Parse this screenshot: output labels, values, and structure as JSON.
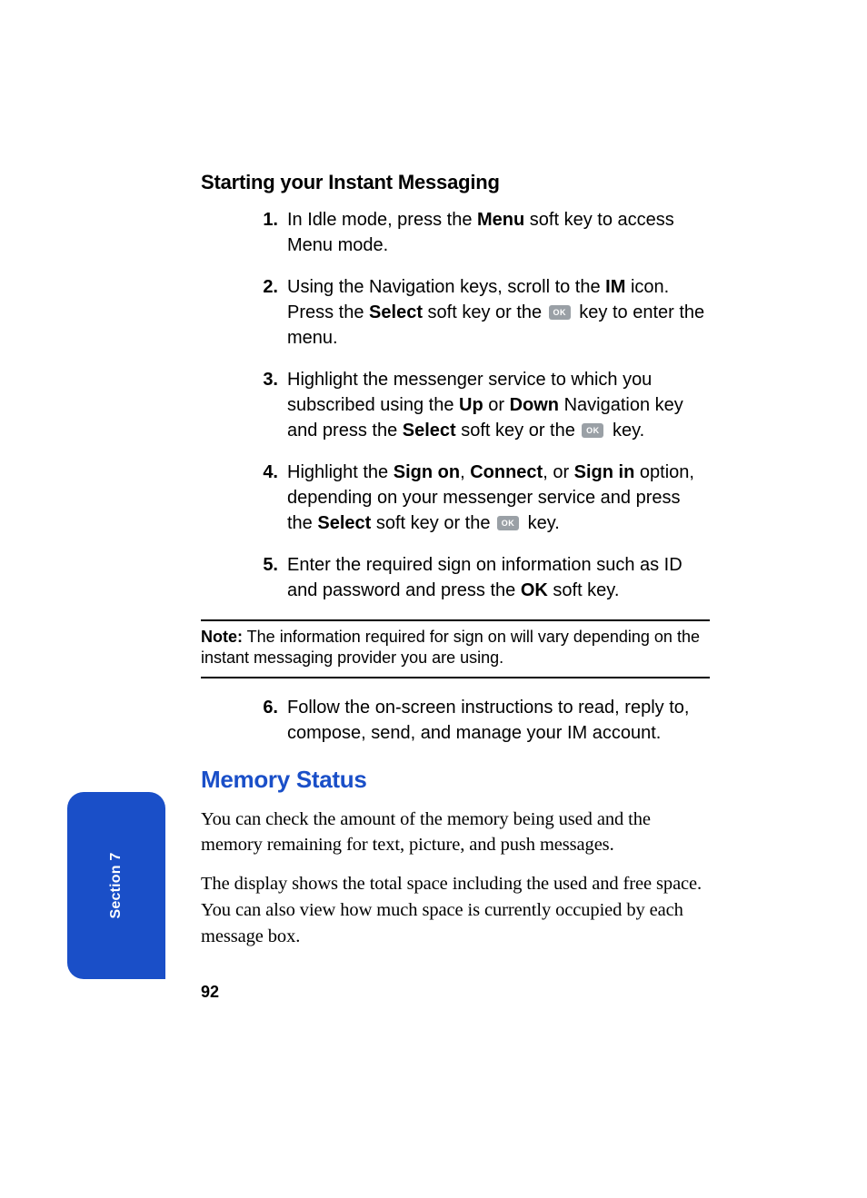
{
  "subheading": "Starting your Instant Messaging",
  "ok_label": "OK",
  "steps_a": [
    {
      "num": "1.",
      "segments": [
        {
          "t": "In Idle mode, press the "
        },
        {
          "t": "Menu",
          "b": true
        },
        {
          "t": " soft key to access Menu mode."
        }
      ]
    },
    {
      "num": "2.",
      "segments": [
        {
          "t": "Using the Navigation keys, scroll to the "
        },
        {
          "t": "IM",
          "b": true
        },
        {
          "t": " icon. Press the "
        },
        {
          "t": "Select",
          "b": true
        },
        {
          "t": " soft key or the "
        },
        {
          "ok": true
        },
        {
          "t": " key to enter the menu."
        }
      ]
    },
    {
      "num": "3.",
      "segments": [
        {
          "t": "Highlight the messenger service to which you subscribed using the "
        },
        {
          "t": "Up",
          "b": true
        },
        {
          "t": " or "
        },
        {
          "t": "Down",
          "b": true
        },
        {
          "t": " Navigation key and press the "
        },
        {
          "t": "Select",
          "b": true
        },
        {
          "t": " soft key or the "
        },
        {
          "ok": true
        },
        {
          "t": " key."
        }
      ]
    },
    {
      "num": "4.",
      "segments": [
        {
          "t": "Highlight the "
        },
        {
          "t": "Sign on",
          "b": true
        },
        {
          "t": ", "
        },
        {
          "t": "Connect",
          "b": true
        },
        {
          "t": ", or "
        },
        {
          "t": "Sign in",
          "b": true
        },
        {
          "t": " option, depending on your messenger service and press the "
        },
        {
          "t": "Select",
          "b": true
        },
        {
          "t": " soft key or the "
        },
        {
          "ok": true
        },
        {
          "t": " key."
        }
      ]
    },
    {
      "num": "5.",
      "segments": [
        {
          "t": "Enter the required sign on information such as ID and password and press the "
        },
        {
          "t": "OK",
          "b": true
        },
        {
          "t": " soft key."
        }
      ]
    }
  ],
  "note": {
    "label": "Note:",
    "text": " The information required for sign on will vary depending on the instant messaging provider you are using."
  },
  "steps_b": [
    {
      "num": "6.",
      "segments": [
        {
          "t": "Follow the on-screen instructions to read, reply to, compose, send, and manage your IM account."
        }
      ]
    }
  ],
  "section_title": "Memory Status",
  "paragraphs": [
    "You can check the amount of the memory being used and the memory remaining for text, picture, and push messages.",
    "The display shows the total space including the used and free space. You can also view how much space is currently occupied by each message box."
  ],
  "side_tab": "Section 7",
  "page_number": "92"
}
